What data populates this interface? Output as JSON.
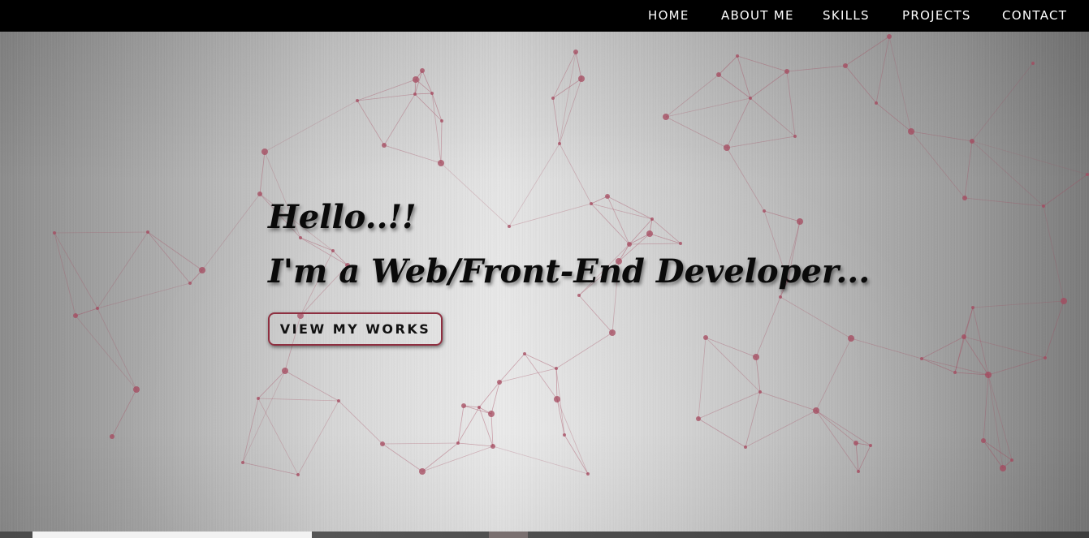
{
  "nav": {
    "items": [
      {
        "label": "HOME"
      },
      {
        "label": "ABOUT ME"
      },
      {
        "label": "SKILLS"
      },
      {
        "label": "PROJECTS"
      },
      {
        "label": "CONTACT"
      }
    ]
  },
  "hero": {
    "greeting": "Hello..!!",
    "role": "I'm a Web/Front-End Developer...",
    "cta_label": "VIEW MY WORKS"
  },
  "colors": {
    "nav_background": "#000000",
    "nav_text": "#ffffff",
    "particle": "#a4485e",
    "button_border": "#8e2f40",
    "heading_text": "#0a0a0a"
  },
  "icons": {
    "background_effect": "particle-network"
  }
}
